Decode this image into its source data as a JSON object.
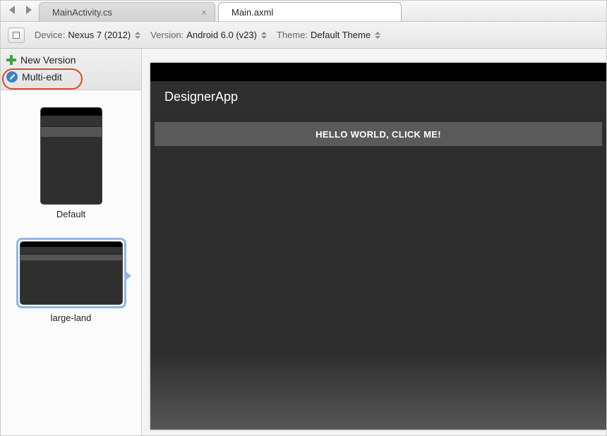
{
  "tabs": {
    "inactive": "MainActivity.cs",
    "active": "Main.axml"
  },
  "toolbar": {
    "device_label": "Device:",
    "device_value": "Nexus 7 (2012)",
    "version_label": "Version:",
    "version_value": "Android 6.0 (v23)",
    "theme_label": "Theme:",
    "theme_value": "Default Theme"
  },
  "sidebar": {
    "new_version": "New Version",
    "multi_edit": "Multi-edit",
    "thumbs": [
      {
        "label": "Default"
      },
      {
        "label": "large-land"
      }
    ]
  },
  "device_preview": {
    "app_title": "DesignerApp",
    "button_text": "HELLO WORLD, CLICK ME!"
  }
}
